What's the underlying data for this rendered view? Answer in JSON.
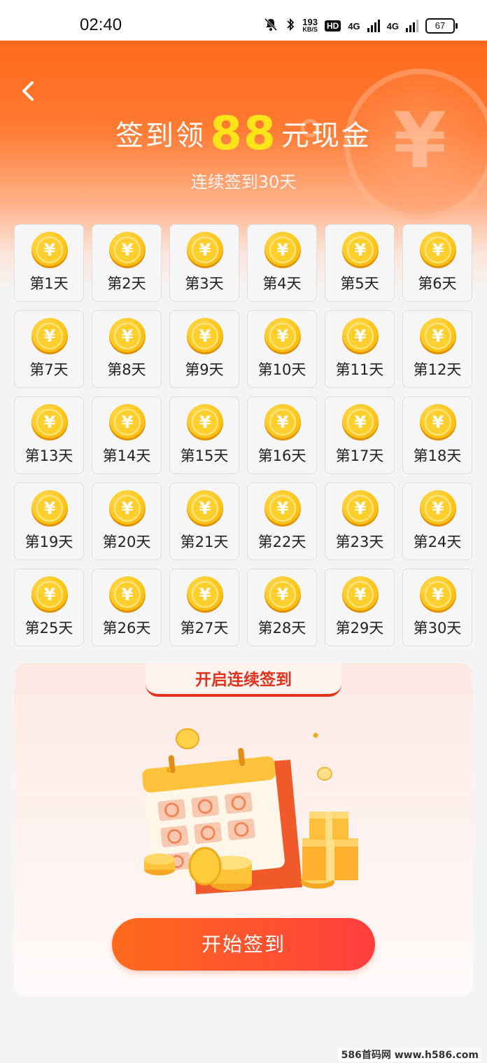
{
  "status_bar": {
    "time": "02:40",
    "speed_value": "193",
    "speed_unit": "KB/S",
    "hd_label": "HD",
    "net1": "4G",
    "net2": "4G",
    "battery": "67"
  },
  "header": {
    "title_prefix": "签到领",
    "title_amount": "88",
    "title_suffix": "元现金",
    "subtitle": "连续签到30天",
    "coin_symbol": "¥"
  },
  "days": [
    "第1天",
    "第2天",
    "第3天",
    "第4天",
    "第5天",
    "第6天",
    "第7天",
    "第8天",
    "第9天",
    "第10天",
    "第11天",
    "第12天",
    "第13天",
    "第14天",
    "第15天",
    "第16天",
    "第17天",
    "第18天",
    "第19天",
    "第20天",
    "第21天",
    "第22天",
    "第23天",
    "第24天",
    "第25天",
    "第26天",
    "第27天",
    "第28天",
    "第29天",
    "第30天"
  ],
  "promo": {
    "tab_label": "开启连续签到",
    "button_label": "开始签到"
  },
  "watermark": "586首码网 www.h586.com",
  "colors": {
    "brand_orange": "#ff6a1c",
    "title_yellow": "#ffe41a",
    "coin_gold": "#ffc61a",
    "tab_red": "#e2321c",
    "button_red": "#ff3e3e"
  }
}
